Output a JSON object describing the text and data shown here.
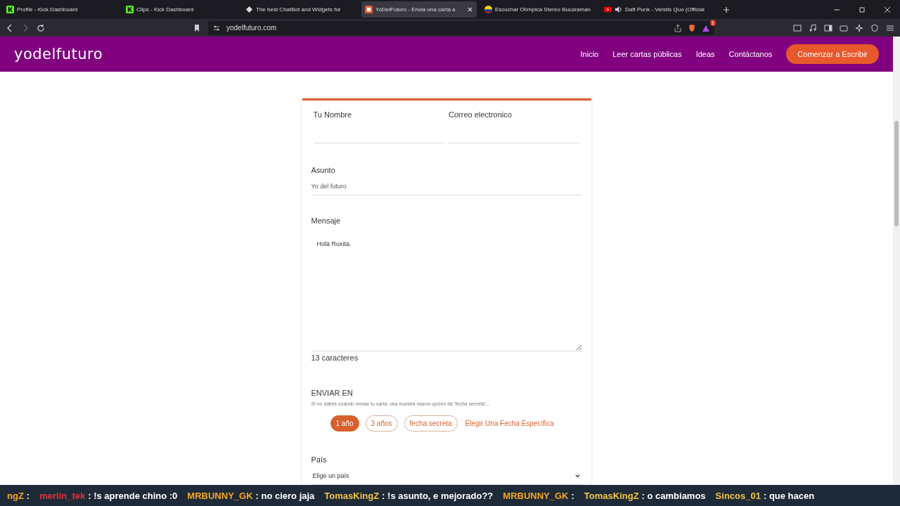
{
  "browser": {
    "tabs": [
      {
        "title": "Profile - Kick Dashboard",
        "kind": "kick",
        "selected": false,
        "audio": false
      },
      {
        "title": "Clips - Kick Dashboard",
        "kind": "kick",
        "selected": false,
        "audio": false
      },
      {
        "title": "The best ChatBot and Widgets for",
        "kind": "diamond",
        "selected": false,
        "audio": false
      },
      {
        "title": "YoDelFuturo - Envia una carta a",
        "kind": "letter",
        "selected": true,
        "audio": false
      },
      {
        "title": "Escuchar Olímpica Stereo Bucaraman",
        "kind": "flag",
        "selected": false,
        "audio": false
      },
      {
        "title": "Daft Punk - Veridis Quo (Official",
        "kind": "video",
        "selected": false,
        "audio": true
      }
    ],
    "url": "yodelfuturo.com",
    "shield_badge": "1"
  },
  "site": {
    "logo": "yodelfuturo",
    "nav": [
      "Inicio",
      "Leer cartas públicas",
      "Ideas",
      "Contáctanos"
    ],
    "cta": "Comenzar a Escribir"
  },
  "form": {
    "name_label": "Tu Nombre",
    "email_label": "Correo electronico",
    "subject_label": "Asunto",
    "subject_value": "Yo del futuro",
    "message_label": "Mensaje",
    "message_value": "Hola Ruxita.",
    "char_count": "13 caracteres",
    "send_label": "ENVIAR EN",
    "send_hint": "Si no sabes cuando enviar tu carta, usa nuestra nueva opción de 'fecha secreta'...",
    "send_options": [
      {
        "label": "1 año",
        "selected": true
      },
      {
        "label": "3 años",
        "selected": false
      },
      {
        "label": "fecha secreta",
        "selected": false
      }
    ],
    "specific_date": "Elegir Una Fecha Específica",
    "country_label": "País",
    "country_value": "Elige un país"
  },
  "chat": [
    {
      "user": "ngZ",
      "text": ":",
      "color": "#f5a623"
    },
    {
      "user": "merlin_tek",
      "text": ": !s aprende chino :0",
      "color": "#e8303a"
    },
    {
      "user": "MRBUNNY_GK",
      "text": ": no ciero jaja",
      "color": "#f5a623"
    },
    {
      "user": "TomasKingZ",
      "text": ": !s asunto, e mejorado??",
      "color": "#f5c542"
    },
    {
      "user": "MRBUNNY_GK",
      "text": ":",
      "color": "#f5a623"
    },
    {
      "user": "TomasKingZ",
      "text": ": o cambiamos",
      "color": "#f5c542"
    },
    {
      "user": "Sincos_01",
      "text": ": que hacen",
      "color": "#f5c542"
    }
  ]
}
